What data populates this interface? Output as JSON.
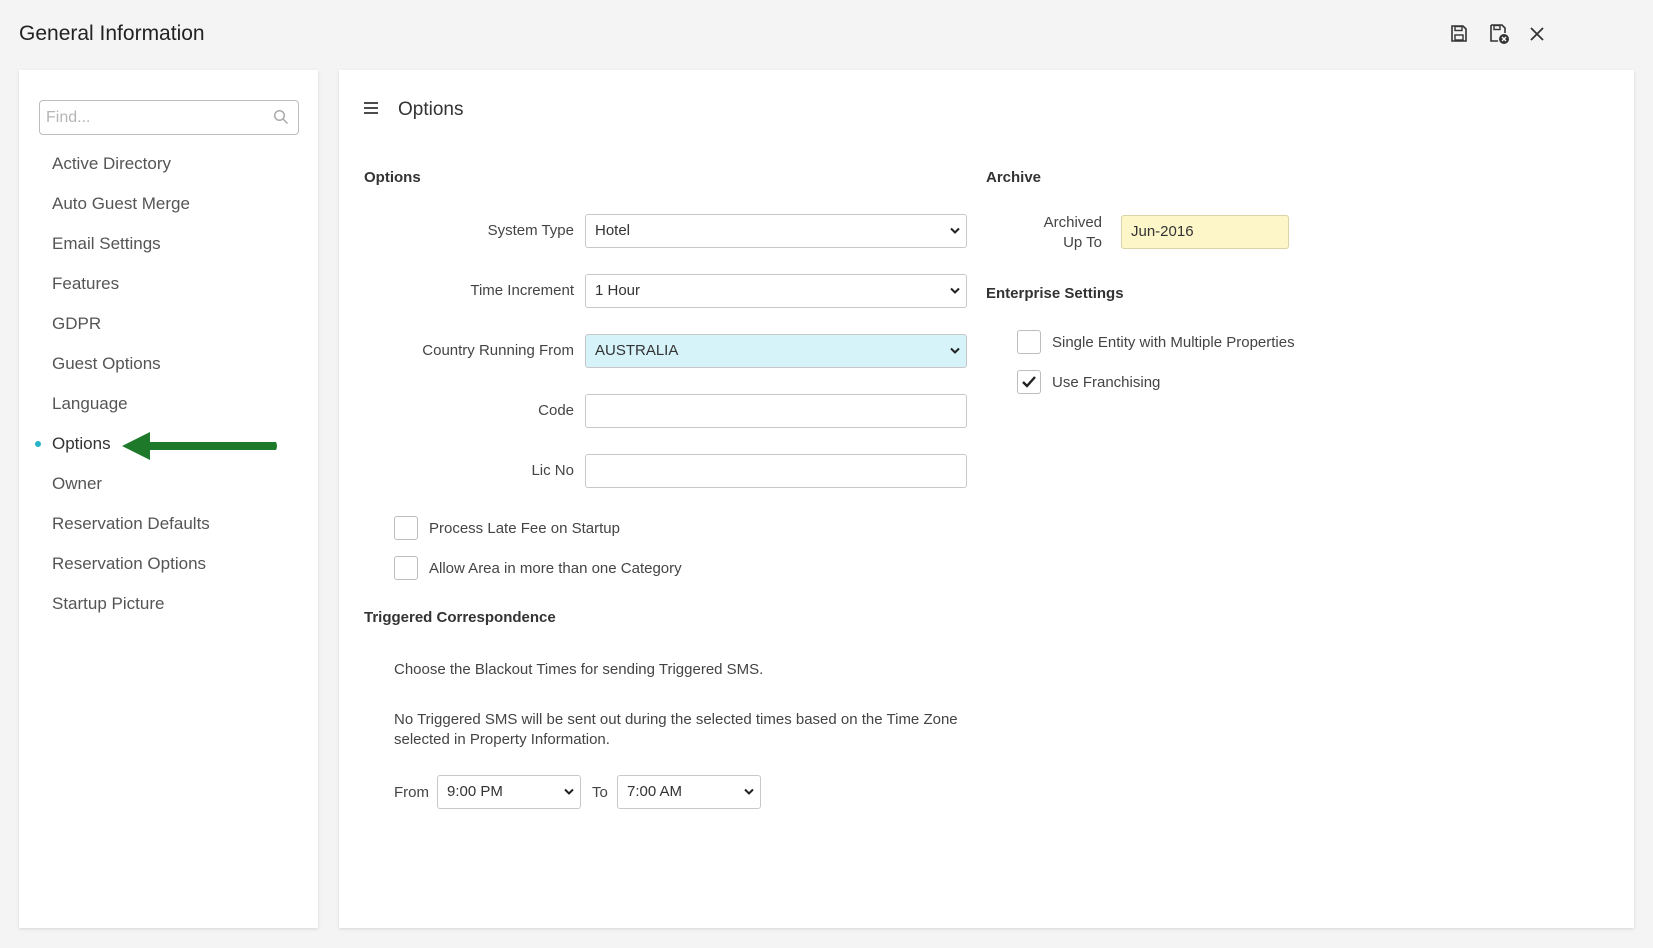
{
  "window": {
    "title": "General Information"
  },
  "sidebar": {
    "search_placeholder": "Find...",
    "items": [
      {
        "label": "Active Directory"
      },
      {
        "label": "Auto Guest Merge"
      },
      {
        "label": "Email Settings"
      },
      {
        "label": "Features"
      },
      {
        "label": "GDPR"
      },
      {
        "label": "Guest Options"
      },
      {
        "label": "Language"
      },
      {
        "label": "Options",
        "active": true
      },
      {
        "label": "Owner"
      },
      {
        "label": "Reservation Defaults"
      },
      {
        "label": "Reservation Options"
      },
      {
        "label": "Startup Picture"
      }
    ]
  },
  "main": {
    "title": "Options",
    "options": {
      "heading": "Options",
      "system_type_label": "System Type",
      "system_type_value": "Hotel",
      "time_increment_label": "Time Increment",
      "time_increment_value": "1 Hour",
      "country_label": "Country Running From",
      "country_value": "AUSTRALIA",
      "code_label": "Code",
      "code_value": "",
      "lic_label": "Lic No",
      "lic_value": "",
      "late_fee_label": "Process Late Fee on Startup",
      "late_fee_checked": false,
      "allow_area_label": "Allow Area in more than one Category",
      "allow_area_checked": false
    },
    "archive": {
      "heading": "Archive",
      "archived_label_line1": "Archived",
      "archived_label_line2": "Up To",
      "archived_value": "Jun-2016"
    },
    "enterprise": {
      "heading": "Enterprise Settings",
      "single_entity_label": "Single Entity with Multiple Properties",
      "single_entity_checked": false,
      "franchising_label": "Use Franchising",
      "franchising_checked": true
    },
    "triggered": {
      "heading": "Triggered Correspondence",
      "text1": "Choose the Blackout Times for sending Triggered SMS.",
      "text2_line1": "No Triggered SMS will be sent out during the selected times based on the Time Zone",
      "text2_line2": "selected in Property Information.",
      "from_label": "From",
      "from_value": "9:00 PM",
      "to_label": "To",
      "to_value": "7:00 AM"
    }
  },
  "colors": {
    "accent": "#26b5c8",
    "arrow": "#1e7a2a",
    "country_bg": "#d6f3f9",
    "archive_bg": "#fdf6c8"
  }
}
